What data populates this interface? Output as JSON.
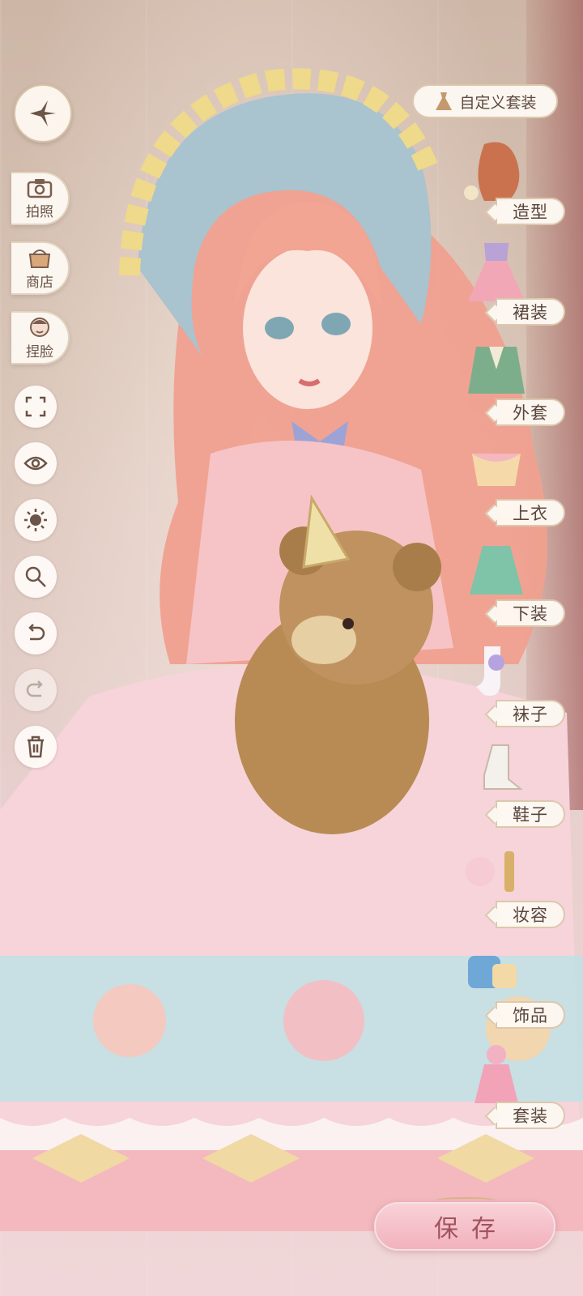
{
  "toolbar": {
    "compass_icon": "compass-star-icon",
    "photo_label": "拍照",
    "shop_label": "商店",
    "face_label": "捏脸",
    "tools": [
      "fullscreen-icon",
      "eye-icon",
      "brightness-icon",
      "zoom-icon",
      "undo-icon",
      "redo-icon",
      "trash-icon"
    ]
  },
  "custom_outfit": {
    "label": "自定义套装"
  },
  "categories": [
    {
      "id": "hairstyle",
      "label": "造型"
    },
    {
      "id": "dress",
      "label": "裙装"
    },
    {
      "id": "coat",
      "label": "外套"
    },
    {
      "id": "top",
      "label": "上衣"
    },
    {
      "id": "bottom",
      "label": "下装"
    },
    {
      "id": "socks",
      "label": "袜子"
    },
    {
      "id": "shoes",
      "label": "鞋子"
    },
    {
      "id": "makeup",
      "label": "妆容"
    },
    {
      "id": "accessories",
      "label": "饰品"
    },
    {
      "id": "sets",
      "label": "套装"
    }
  ],
  "save": {
    "label": "保存"
  },
  "colors": {
    "accent": "#f2b2bd",
    "panel": "#fbf6ef",
    "text": "#5a463d"
  }
}
